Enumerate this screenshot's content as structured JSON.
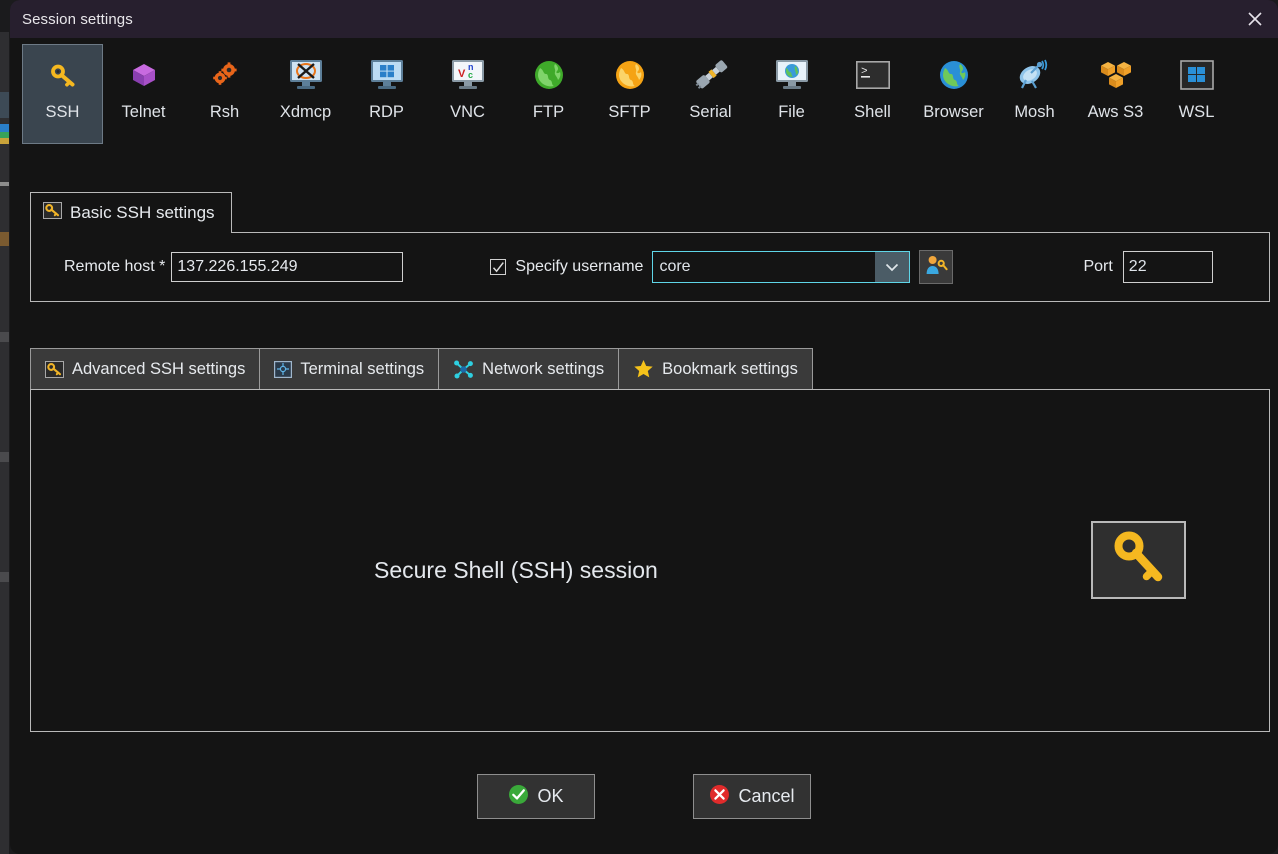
{
  "window": {
    "title": "Session settings",
    "close_icon": "close-icon",
    "titlebar_color": "#271f2e",
    "body_color": "#141414"
  },
  "session_types": [
    {
      "label": "SSH",
      "icon": "key-icon",
      "selected": true
    },
    {
      "label": "Telnet",
      "icon": "purple-cube-icon",
      "selected": false
    },
    {
      "label": "Rsh",
      "icon": "orange-gears-icon",
      "selected": false
    },
    {
      "label": "Xdmcp",
      "icon": "xdmcp-monitor-icon",
      "selected": false
    },
    {
      "label": "RDP",
      "icon": "windows-monitor-icon",
      "selected": false
    },
    {
      "label": "VNC",
      "icon": "vnc-monitor-icon",
      "selected": false
    },
    {
      "label": "FTP",
      "icon": "green-globe-icon",
      "selected": false
    },
    {
      "label": "SFTP",
      "icon": "orange-globe-icon",
      "selected": false
    },
    {
      "label": "Serial",
      "icon": "plug-connector-icon",
      "selected": false
    },
    {
      "label": "File",
      "icon": "file-monitor-icon",
      "selected": false
    },
    {
      "label": "Shell",
      "icon": "terminal-prompt-icon",
      "selected": false
    },
    {
      "label": "Browser",
      "icon": "blue-globe-icon",
      "selected": false
    },
    {
      "label": "Mosh",
      "icon": "satellite-dish-icon",
      "selected": false
    },
    {
      "label": "Aws S3",
      "icon": "aws-cubes-icon",
      "selected": false
    },
    {
      "label": "WSL",
      "icon": "windows-logo-icon",
      "selected": false
    }
  ],
  "basic_settings": {
    "group_title": "Basic SSH settings",
    "group_icon": "key-icon",
    "remote_host_label": "Remote host *",
    "remote_host_value": "137.226.155.249",
    "specify_username_label": "Specify username",
    "specify_username_checked": true,
    "username_value": "core",
    "username_dropdown_icon": "chevron-down-icon",
    "user_key_button_icon": "user-key-icon",
    "port_label": "Port",
    "port_value": "22",
    "spinner_up_icon": "triangle-up-icon",
    "spinner_down_icon": "triangle-down-icon"
  },
  "tabs": [
    {
      "label": "Advanced SSH settings",
      "icon": "key-icon",
      "active": false
    },
    {
      "label": "Terminal settings",
      "icon": "terminal-icon",
      "active": false
    },
    {
      "label": "Network settings",
      "icon": "network-icon",
      "active": false
    },
    {
      "label": "Bookmark settings",
      "icon": "star-icon",
      "active": false
    }
  ],
  "panel": {
    "description": "Secure Shell (SSH) session",
    "illustration_icon": "key-icon"
  },
  "footer": {
    "ok_label": "OK",
    "ok_icon": "check-circle-icon",
    "cancel_label": "Cancel",
    "cancel_icon": "x-circle-icon"
  },
  "colors": {
    "accent_gold": "#f0b428",
    "selected_tile": "#3a454f",
    "ok_green": "#3aa93a",
    "cancel_red": "#e02b2b",
    "combo_focus": "#5fd6e8"
  }
}
